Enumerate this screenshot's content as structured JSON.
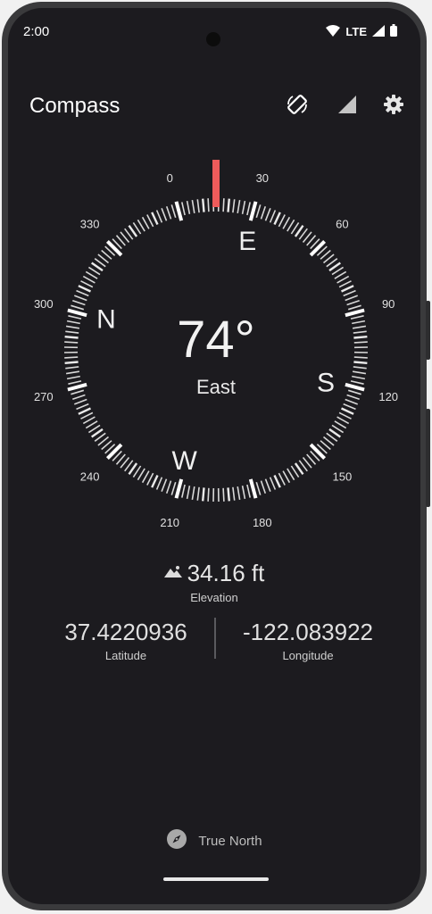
{
  "status_bar": {
    "time": "2:00",
    "network": "LTE"
  },
  "app_bar": {
    "title": "Compass",
    "icons": [
      "auto-rotate-icon",
      "signal-icon",
      "settings-gear-icon"
    ]
  },
  "compass": {
    "heading_degrees": 74,
    "heading_text": "74°",
    "direction": "East",
    "cardinals": {
      "north": "N",
      "east": "E",
      "south": "S",
      "west": "W"
    },
    "dial_labels": [
      "0",
      "30",
      "60",
      "90",
      "120",
      "150",
      "180",
      "210",
      "240",
      "270",
      "300",
      "330"
    ],
    "indicator_color": "#ee5b5b"
  },
  "elevation": {
    "value": "34.16 ft",
    "label": "Elevation"
  },
  "latitude": {
    "value": "37.4220936",
    "label": "Latitude"
  },
  "longitude": {
    "value": "-122.083922",
    "label": "Longitude"
  },
  "footer": {
    "label": "True North"
  }
}
